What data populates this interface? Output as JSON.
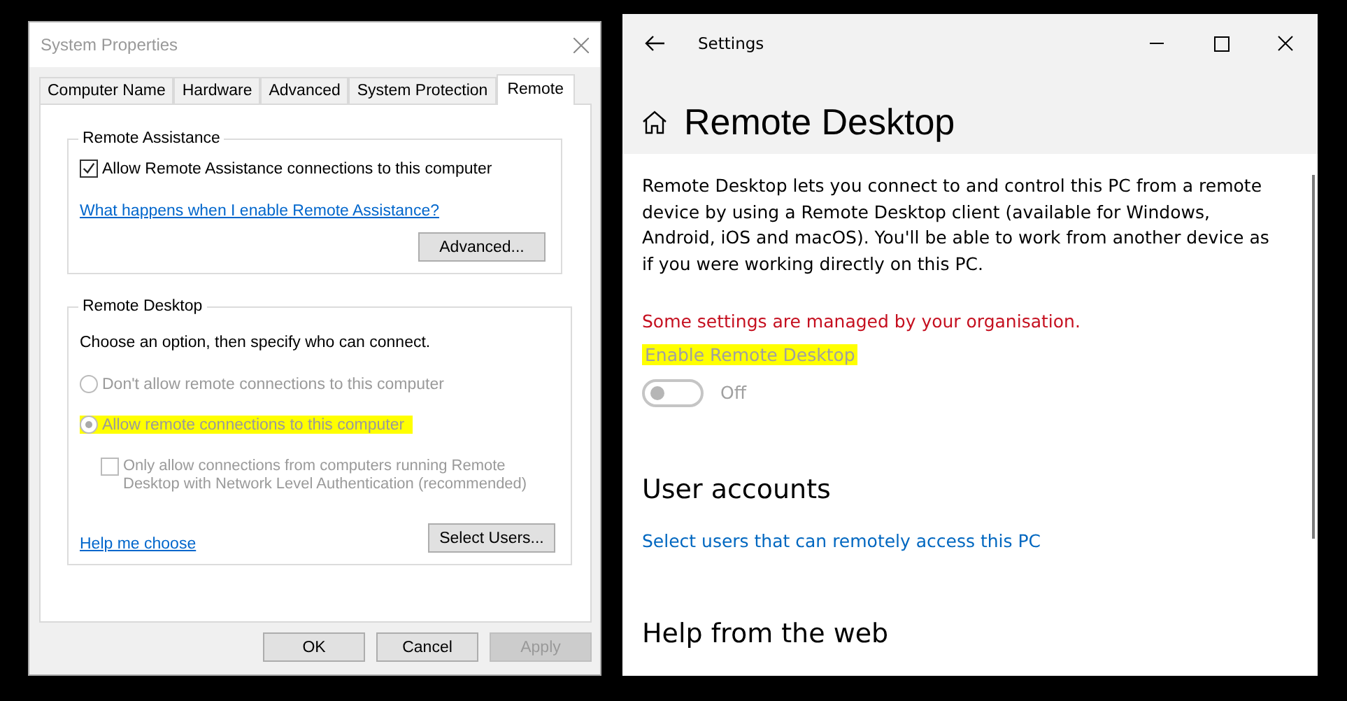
{
  "system_properties": {
    "title": "System Properties",
    "tabs": [
      {
        "label": "Computer Name",
        "selected": false
      },
      {
        "label": "Hardware",
        "selected": false
      },
      {
        "label": "Advanced",
        "selected": false
      },
      {
        "label": "System Protection",
        "selected": false
      },
      {
        "label": "Remote",
        "selected": true
      }
    ],
    "remote_assistance": {
      "heading": "Remote Assistance",
      "checkbox": {
        "label": "Allow Remote Assistance connections to this computer",
        "checked": true
      },
      "link": "What happens when I enable Remote Assistance?",
      "button": "Advanced..."
    },
    "remote_desktop": {
      "heading": "Remote Desktop",
      "instruction": "Choose an option, then specify who can connect.",
      "options": [
        {
          "label": "Don't allow remote connections to this computer",
          "selected": false,
          "disabled": true,
          "highlighted": false
        },
        {
          "label": "Allow remote connections to this computer",
          "selected": true,
          "disabled": true,
          "highlighted": true
        }
      ],
      "nla_checkbox": {
        "label": "Only allow connections from computers running Remote Desktop with Network Level Authentication (recommended)",
        "checked": false,
        "disabled": true
      },
      "link": "Help me choose",
      "button": "Select Users..."
    },
    "buttons": [
      {
        "label": "OK",
        "disabled": false
      },
      {
        "label": "Cancel",
        "disabled": false
      },
      {
        "label": "Apply",
        "disabled": true
      }
    ]
  },
  "settings": {
    "title": "Settings",
    "heading": "Remote Desktop",
    "description": "Remote Desktop lets you connect to and control this PC from a remote device by using a Remote Desktop client (available for Windows, Android, iOS and macOS). You'll be able to work from another device as if you were working directly on this PC.",
    "warning": "Some settings are managed by your organisation.",
    "toggle": {
      "label": "Enable Remote Desktop",
      "on": false,
      "disabled": true,
      "highlighted": true,
      "state_text": "Off"
    },
    "sections": [
      {
        "heading": "User accounts",
        "links": [
          "Select users that can remotely access this PC"
        ]
      },
      {
        "heading": "Help from the web"
      }
    ]
  }
}
